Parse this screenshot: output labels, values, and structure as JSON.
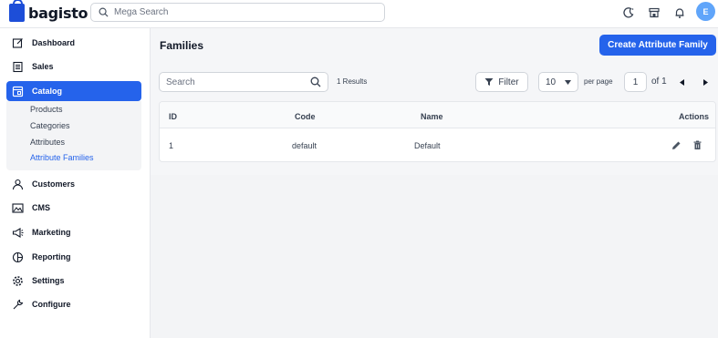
{
  "header": {
    "logo_text": "bagisto",
    "search_placeholder": "Mega Search",
    "avatar_initial": "E"
  },
  "sidebar": {
    "items": [
      {
        "label": "Dashboard",
        "icon": "dashboard-icon"
      },
      {
        "label": "Sales",
        "icon": "sales-icon"
      },
      {
        "label": "Catalog",
        "icon": "catalog-icon",
        "active": true
      },
      {
        "label": "Customers",
        "icon": "customers-icon"
      },
      {
        "label": "CMS",
        "icon": "cms-icon"
      },
      {
        "label": "Marketing",
        "icon": "marketing-icon"
      },
      {
        "label": "Reporting",
        "icon": "reporting-icon"
      },
      {
        "label": "Settings",
        "icon": "settings-icon"
      },
      {
        "label": "Configure",
        "icon": "configure-icon"
      }
    ],
    "catalog_sub": [
      {
        "label": "Products"
      },
      {
        "label": "Categories"
      },
      {
        "label": "Attributes"
      },
      {
        "label": "Attribute Families",
        "active": true
      }
    ]
  },
  "page": {
    "title": "Families",
    "create_button": "Create Attribute Family"
  },
  "toolbar": {
    "search_placeholder": "Search",
    "results": "1 Results",
    "filter_label": "Filter",
    "per_page_value": "10",
    "per_page_label": "per page",
    "page_value": "1",
    "of_label": "of 1"
  },
  "table": {
    "headers": {
      "id": "ID",
      "code": "Code",
      "name": "Name",
      "actions": "Actions"
    },
    "rows": [
      {
        "id": "1",
        "code": "default",
        "name": "Default"
      }
    ]
  },
  "colors": {
    "accent": "#2563eb",
    "avatar": "#60a5fa"
  }
}
